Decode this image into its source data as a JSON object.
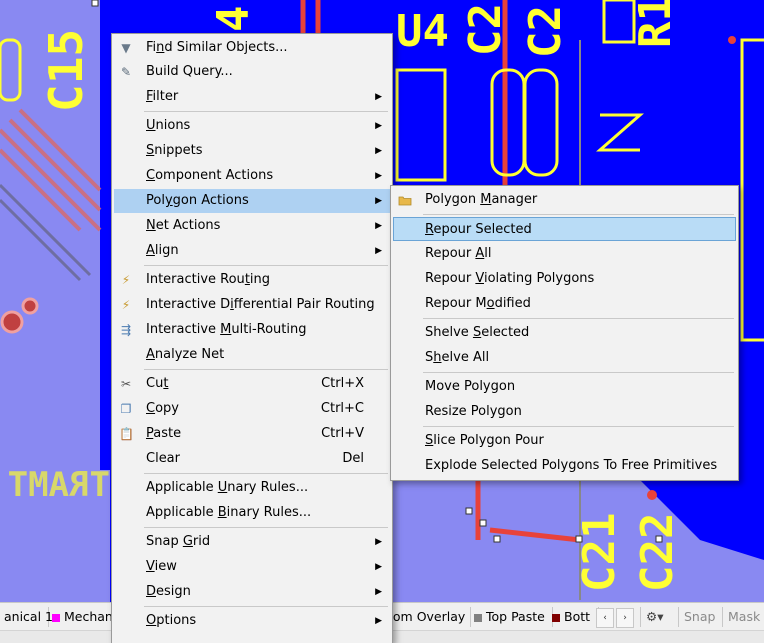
{
  "colors": {
    "board_blue": "#0000ff",
    "board_lavender": "#8989f2",
    "silkscreen_yellow": "#ffff33",
    "track_red": "#e8423a",
    "menu_bg": "#f2f2f2",
    "menu_highlight": "#aed1f2"
  },
  "pcb": {
    "designators": [
      "C15",
      "U4",
      "C2",
      "C2",
      "R1",
      "C21",
      "C22"
    ],
    "fragments": [
      "4",
      "TRAMT"
    ]
  },
  "context_menu": {
    "items": [
      {
        "pre": "Fi",
        "u": "n",
        "post": "d Similar Objects...",
        "icon": "funnel-icon",
        "glyph": "▼"
      },
      {
        "pre": "Build Query...",
        "u": "",
        "post": "",
        "icon": "query-icon",
        "glyph": "✎"
      },
      {
        "pre": "",
        "u": "F",
        "post": "ilter",
        "has_submenu": true
      },
      {
        "pre": "",
        "u": "U",
        "post": "nions",
        "has_submenu": true
      },
      {
        "pre": "",
        "u": "S",
        "post": "nippets",
        "has_submenu": true
      },
      {
        "pre": "",
        "u": "C",
        "post": "omponent Actions",
        "has_submenu": true
      },
      {
        "pre": "Pol",
        "u": "y",
        "post": "gon Actions",
        "has_submenu": true,
        "highlighted": true
      },
      {
        "pre": "",
        "u": "N",
        "post": "et Actions",
        "has_submenu": true
      },
      {
        "pre": "",
        "u": "A",
        "post": "lign",
        "has_submenu": true
      },
      {
        "pre": "Interactive Rou",
        "u": "t",
        "post": "ing",
        "icon": "route-icon",
        "glyph": "⚡"
      },
      {
        "pre": "Interactive D",
        "u": "i",
        "post": "fferential Pair Routing",
        "icon": "diff-pair-icon",
        "glyph": "⚡"
      },
      {
        "pre": "Interactive ",
        "u": "M",
        "post": "ulti-Routing",
        "icon": "multi-route-icon",
        "glyph": "⇶"
      },
      {
        "pre": "",
        "u": "A",
        "post": "nalyze Net"
      },
      {
        "pre": "Cu",
        "u": "t",
        "post": "",
        "shortcut": "Ctrl+X",
        "icon": "scissors-icon",
        "glyph": "✂"
      },
      {
        "pre": "",
        "u": "C",
        "post": "opy",
        "shortcut": "Ctrl+C",
        "icon": "copy-icon",
        "glyph": "❐"
      },
      {
        "pre": "",
        "u": "P",
        "post": "aste",
        "shortcut": "Ctrl+V",
        "icon": "paste-icon",
        "glyph": "📋"
      },
      {
        "pre": "Clear",
        "u": "",
        "post": "",
        "shortcut": "Del"
      },
      {
        "pre": "Applicable ",
        "u": "U",
        "post": "nary Rules..."
      },
      {
        "pre": "Applicable ",
        "u": "B",
        "post": "inary Rules..."
      },
      {
        "pre": "Snap ",
        "u": "G",
        "post": "rid",
        "has_submenu": true
      },
      {
        "pre": "",
        "u": "V",
        "post": "iew",
        "has_submenu": true
      },
      {
        "pre": "",
        "u": "D",
        "post": "esign",
        "has_submenu": true
      },
      {
        "pre": "",
        "u": "O",
        "post": "ptions",
        "has_submenu": true
      }
    ]
  },
  "polygon_submenu": {
    "items": [
      {
        "pre": "Polygon ",
        "u": "M",
        "post": "anager",
        "icon": "folder-icon"
      },
      {
        "pre": "",
        "u": "R",
        "post": "epour Selected",
        "highlighted": true
      },
      {
        "pre": "Repour ",
        "u": "A",
        "post": "ll"
      },
      {
        "pre": "Repour ",
        "u": "V",
        "post": "iolating Polygons"
      },
      {
        "pre": "Repour M",
        "u": "o",
        "post": "dified"
      },
      {
        "pre": "Shelve ",
        "u": "S",
        "post": "elected"
      },
      {
        "pre": "S",
        "u": "h",
        "post": "elve All"
      },
      {
        "pre": "Move Polygon",
        "u": "",
        "post": ""
      },
      {
        "pre": "Resize Polygon",
        "u": "",
        "post": ""
      },
      {
        "pre": "",
        "u": "S",
        "post": "lice Polygon Pour"
      },
      {
        "pre": "Explode Selected Polygons To Free Primitives",
        "u": "",
        "post": ""
      }
    ]
  },
  "layer_tabs": [
    {
      "label": "anical 1",
      "color": ""
    },
    {
      "label": "Mechan",
      "color": "#ff00ff"
    },
    {
      "label": "tom Overlay",
      "color": ""
    },
    {
      "label": "Top Paste",
      "color": "#808080"
    },
    {
      "label": "Bott",
      "color": "#800000"
    }
  ],
  "layer_bar": {
    "nav_prev": "‹",
    "nav_next": "›",
    "snap_label": "Snap",
    "mask_label": "Mask"
  }
}
